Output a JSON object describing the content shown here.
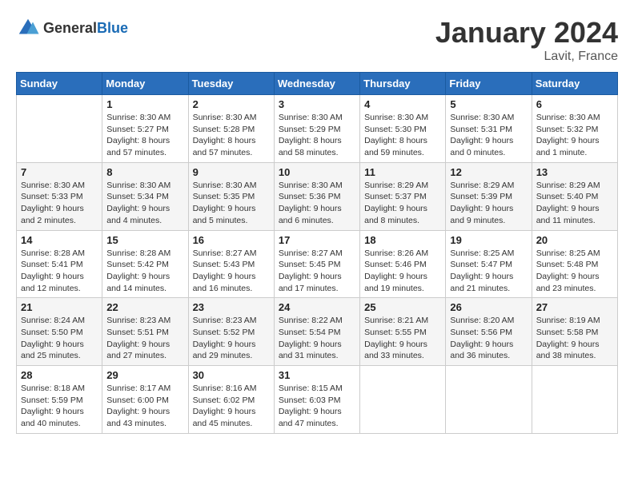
{
  "logo": {
    "general": "General",
    "blue": "Blue"
  },
  "title": "January 2024",
  "location": "Lavit, France",
  "days_of_week": [
    "Sunday",
    "Monday",
    "Tuesday",
    "Wednesday",
    "Thursday",
    "Friday",
    "Saturday"
  ],
  "weeks": [
    [
      {
        "day": "",
        "info": ""
      },
      {
        "day": "1",
        "info": "Sunrise: 8:30 AM\nSunset: 5:27 PM\nDaylight: 8 hours\nand 57 minutes."
      },
      {
        "day": "2",
        "info": "Sunrise: 8:30 AM\nSunset: 5:28 PM\nDaylight: 8 hours\nand 57 minutes."
      },
      {
        "day": "3",
        "info": "Sunrise: 8:30 AM\nSunset: 5:29 PM\nDaylight: 8 hours\nand 58 minutes."
      },
      {
        "day": "4",
        "info": "Sunrise: 8:30 AM\nSunset: 5:30 PM\nDaylight: 8 hours\nand 59 minutes."
      },
      {
        "day": "5",
        "info": "Sunrise: 8:30 AM\nSunset: 5:31 PM\nDaylight: 9 hours\nand 0 minutes."
      },
      {
        "day": "6",
        "info": "Sunrise: 8:30 AM\nSunset: 5:32 PM\nDaylight: 9 hours\nand 1 minute."
      }
    ],
    [
      {
        "day": "7",
        "info": "Sunrise: 8:30 AM\nSunset: 5:33 PM\nDaylight: 9 hours\nand 2 minutes."
      },
      {
        "day": "8",
        "info": "Sunrise: 8:30 AM\nSunset: 5:34 PM\nDaylight: 9 hours\nand 4 minutes."
      },
      {
        "day": "9",
        "info": "Sunrise: 8:30 AM\nSunset: 5:35 PM\nDaylight: 9 hours\nand 5 minutes."
      },
      {
        "day": "10",
        "info": "Sunrise: 8:30 AM\nSunset: 5:36 PM\nDaylight: 9 hours\nand 6 minutes."
      },
      {
        "day": "11",
        "info": "Sunrise: 8:29 AM\nSunset: 5:37 PM\nDaylight: 9 hours\nand 8 minutes."
      },
      {
        "day": "12",
        "info": "Sunrise: 8:29 AM\nSunset: 5:39 PM\nDaylight: 9 hours\nand 9 minutes."
      },
      {
        "day": "13",
        "info": "Sunrise: 8:29 AM\nSunset: 5:40 PM\nDaylight: 9 hours\nand 11 minutes."
      }
    ],
    [
      {
        "day": "14",
        "info": "Sunrise: 8:28 AM\nSunset: 5:41 PM\nDaylight: 9 hours\nand 12 minutes."
      },
      {
        "day": "15",
        "info": "Sunrise: 8:28 AM\nSunset: 5:42 PM\nDaylight: 9 hours\nand 14 minutes."
      },
      {
        "day": "16",
        "info": "Sunrise: 8:27 AM\nSunset: 5:43 PM\nDaylight: 9 hours\nand 16 minutes."
      },
      {
        "day": "17",
        "info": "Sunrise: 8:27 AM\nSunset: 5:45 PM\nDaylight: 9 hours\nand 17 minutes."
      },
      {
        "day": "18",
        "info": "Sunrise: 8:26 AM\nSunset: 5:46 PM\nDaylight: 9 hours\nand 19 minutes."
      },
      {
        "day": "19",
        "info": "Sunrise: 8:25 AM\nSunset: 5:47 PM\nDaylight: 9 hours\nand 21 minutes."
      },
      {
        "day": "20",
        "info": "Sunrise: 8:25 AM\nSunset: 5:48 PM\nDaylight: 9 hours\nand 23 minutes."
      }
    ],
    [
      {
        "day": "21",
        "info": "Sunrise: 8:24 AM\nSunset: 5:50 PM\nDaylight: 9 hours\nand 25 minutes."
      },
      {
        "day": "22",
        "info": "Sunrise: 8:23 AM\nSunset: 5:51 PM\nDaylight: 9 hours\nand 27 minutes."
      },
      {
        "day": "23",
        "info": "Sunrise: 8:23 AM\nSunset: 5:52 PM\nDaylight: 9 hours\nand 29 minutes."
      },
      {
        "day": "24",
        "info": "Sunrise: 8:22 AM\nSunset: 5:54 PM\nDaylight: 9 hours\nand 31 minutes."
      },
      {
        "day": "25",
        "info": "Sunrise: 8:21 AM\nSunset: 5:55 PM\nDaylight: 9 hours\nand 33 minutes."
      },
      {
        "day": "26",
        "info": "Sunrise: 8:20 AM\nSunset: 5:56 PM\nDaylight: 9 hours\nand 36 minutes."
      },
      {
        "day": "27",
        "info": "Sunrise: 8:19 AM\nSunset: 5:58 PM\nDaylight: 9 hours\nand 38 minutes."
      }
    ],
    [
      {
        "day": "28",
        "info": "Sunrise: 8:18 AM\nSunset: 5:59 PM\nDaylight: 9 hours\nand 40 minutes."
      },
      {
        "day": "29",
        "info": "Sunrise: 8:17 AM\nSunset: 6:00 PM\nDaylight: 9 hours\nand 43 minutes."
      },
      {
        "day": "30",
        "info": "Sunrise: 8:16 AM\nSunset: 6:02 PM\nDaylight: 9 hours\nand 45 minutes."
      },
      {
        "day": "31",
        "info": "Sunrise: 8:15 AM\nSunset: 6:03 PM\nDaylight: 9 hours\nand 47 minutes."
      },
      {
        "day": "",
        "info": ""
      },
      {
        "day": "",
        "info": ""
      },
      {
        "day": "",
        "info": ""
      }
    ]
  ]
}
